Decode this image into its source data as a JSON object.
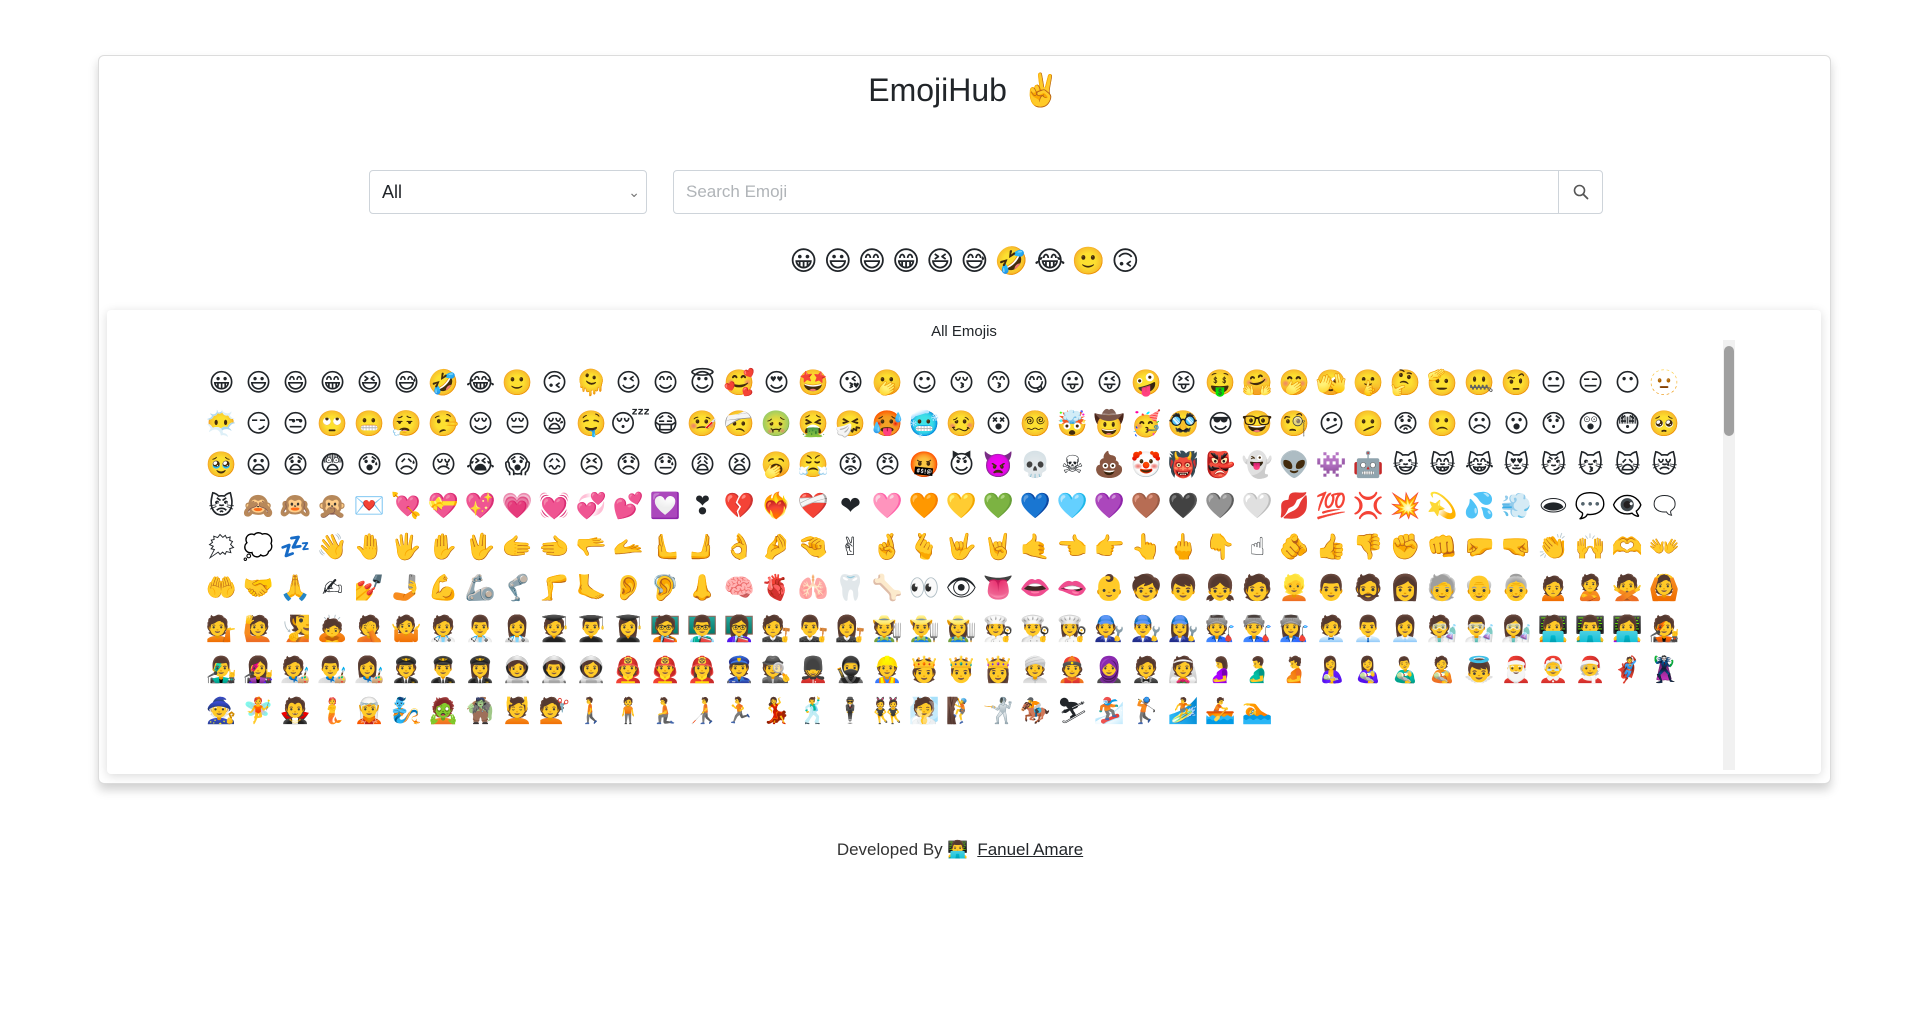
{
  "app": {
    "title": "EmojiHub",
    "title_emoji": "✌️"
  },
  "filters": {
    "category_selected": "All",
    "search_placeholder": "Search Emoji",
    "search_value": ""
  },
  "featured_emojis": [
    "😀",
    "😃",
    "😄",
    "😁",
    "😆",
    "😅",
    "🤣",
    "😂",
    "🙂",
    "🙃"
  ],
  "emoji_list": {
    "title": "All Emojis",
    "emojis": [
      "😀",
      "😃",
      "😄",
      "😁",
      "😆",
      "😅",
      "🤣",
      "😂",
      "🙂",
      "🙃",
      "🫠",
      "😉",
      "😊",
      "😇",
      "🥰",
      "😍",
      "🤩",
      "😘",
      "🫢",
      "☺",
      "😚",
      "😙",
      "😋",
      "😛",
      "😜",
      "🤪",
      "😝",
      "🤑",
      "🤗",
      "🤭",
      "🫣",
      "🤫",
      "🤔",
      "🫡",
      "🤐",
      "🤨",
      "😐",
      "😑",
      "😶",
      "🫥",
      "😶‍🌫️",
      "😏",
      "😒",
      "🙄",
      "😬",
      "😮‍💨",
      "🤥",
      "😌",
      "😔",
      "😪",
      "🤤",
      "😴",
      "😷",
      "🤒",
      "🤕",
      "🤢",
      "🤮",
      "🤧",
      "🥵",
      "🥶",
      "🥴",
      "😵",
      "😵‍💫",
      "🤯",
      "🤠",
      "🥳",
      "🥸",
      "😎",
      "🤓",
      "🧐",
      "😕",
      "🫤",
      "😟",
      "🙁",
      "☹",
      "😮",
      "😯",
      "😲",
      "😳",
      "🥺",
      "🥹",
      "😦",
      "😧",
      "😨",
      "😰",
      "😥",
      "😢",
      "😭",
      "😱",
      "😖",
      "😣",
      "😞",
      "😓",
      "😩",
      "😫",
      "🥱",
      "😤",
      "😡",
      "😠",
      "🤬",
      "😈",
      "👿",
      "💀",
      "☠",
      "💩",
      "🤡",
      "👹",
      "👺",
      "👻",
      "👽",
      "👾",
      "🤖",
      "😺",
      "😸",
      "😹",
      "😻",
      "😼",
      "😽",
      "🙀",
      "😿",
      "😾",
      "🙈",
      "🙉",
      "🙊",
      "💌",
      "💘",
      "💝",
      "💖",
      "💗",
      "💓",
      "💞",
      "💕",
      "💟",
      "❣",
      "💔",
      "❤️‍🔥",
      "❤️‍🩹",
      "❤",
      "🩷",
      "🧡",
      "💛",
      "💚",
      "💙",
      "🩵",
      "💜",
      "🤎",
      "🖤",
      "🩶",
      "🤍",
      "💋",
      "💯",
      "💢",
      "💥",
      "💫",
      "💦",
      "💨",
      "🕳",
      "💬",
      "👁️‍🗨️",
      "🗨",
      "🗯",
      "💭",
      "💤",
      "👋",
      "🤚",
      "🖐",
      "✋",
      "🖖",
      "🫱",
      "🫲",
      "🫳",
      "🫴",
      "🫷",
      "🫸",
      "👌",
      "🤌",
      "🤏",
      "✌",
      "🤞",
      "🫰",
      "🤟",
      "🤘",
      "🤙",
      "👈",
      "👉",
      "👆",
      "🖕",
      "👇",
      "☝",
      "🫵",
      "👍",
      "👎",
      "✊",
      "👊",
      "🤛",
      "🤜",
      "👏",
      "🙌",
      "🫶",
      "👐",
      "🤲",
      "🤝",
      "🙏",
      "✍",
      "💅",
      "🤳",
      "💪",
      "🦾",
      "🦿",
      "🦵",
      "🦶",
      "👂",
      "🦻",
      "👃",
      "🧠",
      "🫀",
      "🫁",
      "🦷",
      "🦴",
      "👀",
      "👁",
      "👅",
      "👄",
      "🫦",
      "👶",
      "🧒",
      "👦",
      "👧",
      "🧑",
      "👱",
      "👨",
      "🧔",
      "👩",
      "🧓",
      "👴",
      "👵",
      "🙍",
      "🙎",
      "🙅",
      "🙆",
      "💁",
      "🙋",
      "🧏",
      "🙇",
      "🤦",
      "🤷",
      "🧑‍⚕️",
      "👨‍⚕️",
      "👩‍⚕️",
      "🧑‍🎓",
      "👨‍🎓",
      "👩‍🎓",
      "🧑‍🏫",
      "👨‍🏫",
      "👩‍🏫",
      "🧑‍⚖️",
      "👨‍⚖️",
      "👩‍⚖️",
      "🧑‍🌾",
      "👨‍🌾",
      "👩‍🌾",
      "🧑‍🍳",
      "👨‍🍳",
      "👩‍🍳",
      "🧑‍🔧",
      "👨‍🔧",
      "👩‍🔧",
      "🧑‍🏭",
      "👨‍🏭",
      "👩‍🏭",
      "🧑‍💼",
      "👨‍💼",
      "👩‍💼",
      "🧑‍🔬",
      "👨‍🔬",
      "👩‍🔬",
      "🧑‍💻",
      "👨‍💻",
      "👩‍💻",
      "🧑‍🎤",
      "👨‍🎤",
      "👩‍🎤",
      "🧑‍🎨",
      "👨‍🎨",
      "👩‍🎨",
      "🧑‍✈️",
      "👨‍✈️",
      "👩‍✈️",
      "🧑‍🚀",
      "👨‍🚀",
      "👩‍🚀",
      "🧑‍🚒",
      "👨‍🚒",
      "👩‍🚒",
      "👮",
      "🕵",
      "💂",
      "🥷",
      "👷",
      "🫅",
      "🤴",
      "👸",
      "👳",
      "👲",
      "🧕",
      "🤵",
      "👰",
      "🤰",
      "🫃",
      "🫄",
      "🤱",
      "👩‍🍼",
      "👨‍🍼",
      "🧑‍🍼",
      "👼",
      "🎅",
      "🤶",
      "🧑‍🎄",
      "🦸",
      "🦹",
      "🧙",
      "🧚",
      "🧛",
      "🧜",
      "🧝",
      "🧞",
      "🧟",
      "🧌",
      "💆",
      "💇",
      "🚶",
      "🧍",
      "🧎",
      "🧑‍🦯",
      "🏃",
      "💃",
      "🕺",
      "🕴",
      "👯",
      "🧖",
      "🧗",
      "🤺",
      "🏇",
      "⛷",
      "🏂",
      "🏌",
      "🏄",
      "🚣",
      "🏊"
    ]
  },
  "footer": {
    "prefix": "Developed By",
    "icon": "👨‍💻",
    "author": "Fanuel Amare"
  }
}
